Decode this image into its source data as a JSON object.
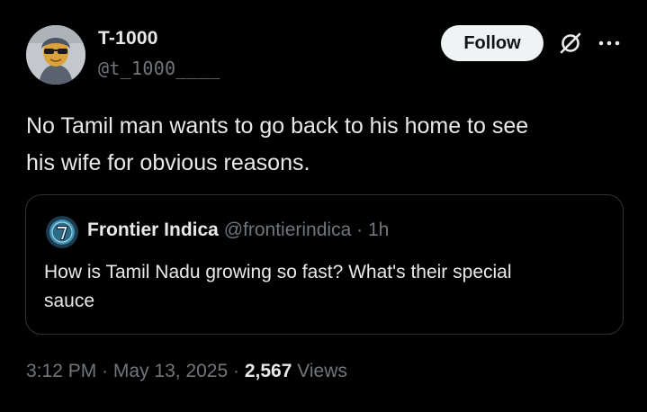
{
  "author": {
    "display_name": "T-1000",
    "handle": "@t_1000____",
    "avatar_icon": "avatar-sunglasses"
  },
  "actions": {
    "follow_label": "Follow",
    "grok_icon": "grok-icon",
    "more_icon": "more-icon"
  },
  "tweet": {
    "text_line1": "No Tamil man wants to go back to his home to see",
    "text_line2": "his wife for obvious reasons."
  },
  "quote": {
    "display_name": "Frontier Indica",
    "handle": "@frontierindica",
    "separator": "·",
    "time": "1h",
    "text_line1": "How is Tamil Nadu growing so fast? What's their special",
    "text_line2": "sauce",
    "avatar_icon": "frontier-indica-logo"
  },
  "meta": {
    "time": "3:12 PM",
    "separator1": "·",
    "date": "May 13, 2025",
    "separator2": "·",
    "views_count": "2,567",
    "views_label": "Views"
  },
  "colors": {
    "background": "#000000",
    "primary_text": "#e7e9ea",
    "secondary_text": "#71767b",
    "border": "#2f3336",
    "follow_bg": "#eff3f4"
  }
}
